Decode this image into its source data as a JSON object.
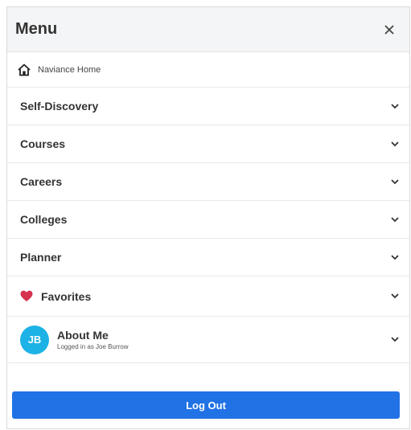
{
  "header": {
    "title": "Menu",
    "close_icon": "close-icon"
  },
  "home": {
    "label": "Naviance Home",
    "icon": "home-icon"
  },
  "nav_items": [
    {
      "label": "Self-Discovery"
    },
    {
      "label": "Courses"
    },
    {
      "label": "Careers"
    },
    {
      "label": "Colleges"
    },
    {
      "label": "Planner"
    }
  ],
  "favorites": {
    "label": "Favorites",
    "icon": "heart-icon",
    "icon_color": "#d6334e"
  },
  "about": {
    "initials": "JB",
    "title": "About Me",
    "subtitle": "Logged in as Joe Burrow",
    "avatar_color": "#1cb2e6"
  },
  "logout": {
    "label": "Log Out",
    "color": "#2172e5"
  }
}
